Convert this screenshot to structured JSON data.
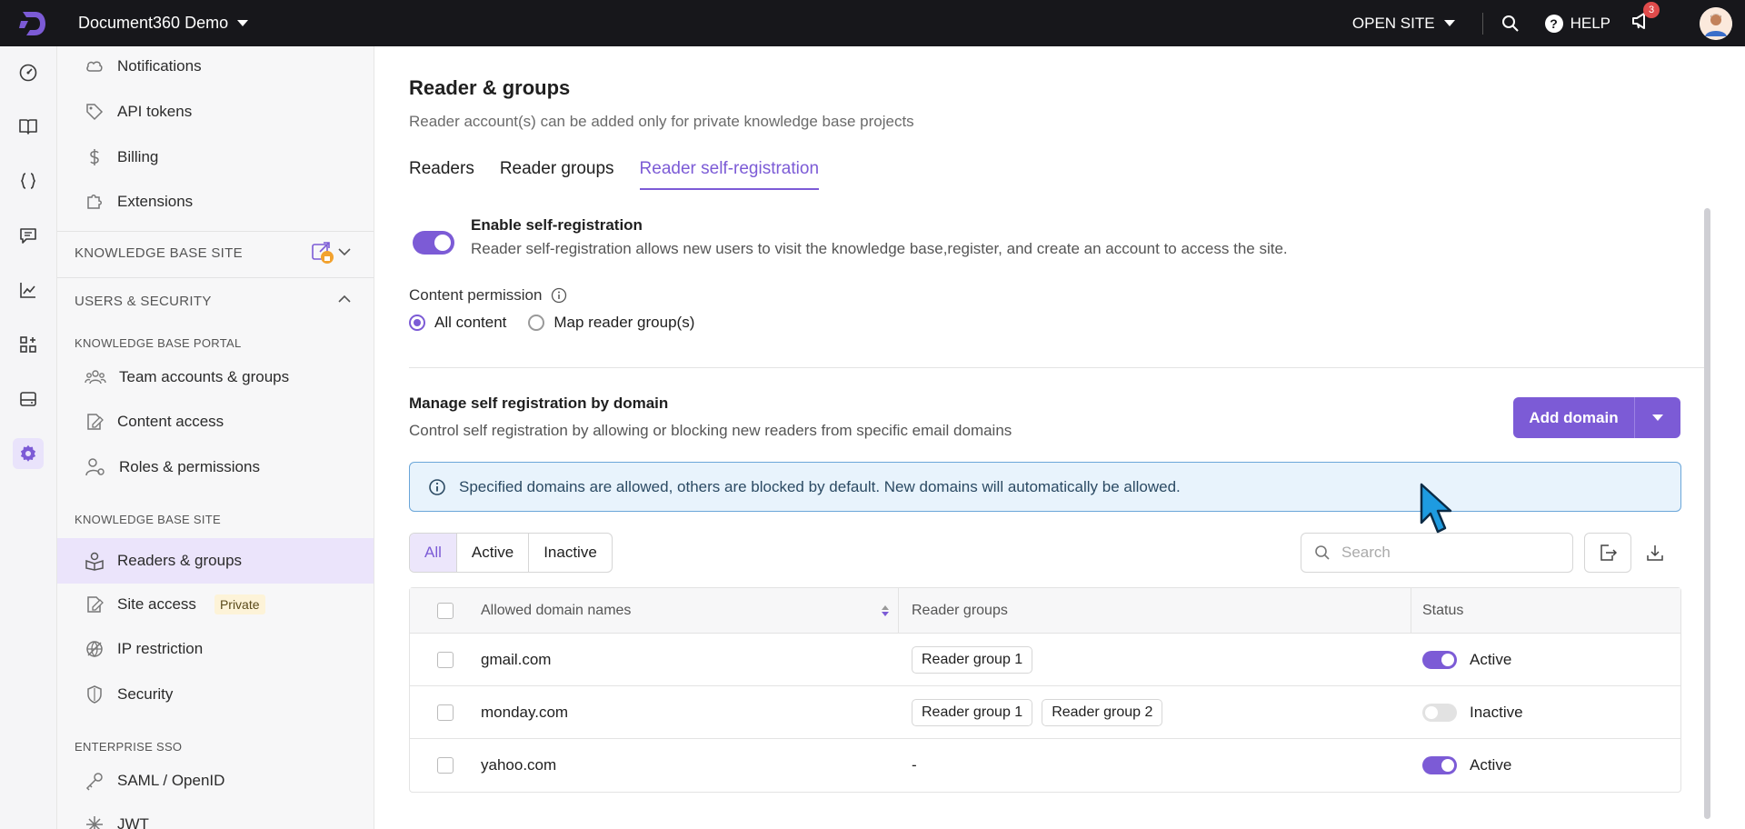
{
  "topbar": {
    "project_name": "Document360 Demo",
    "open_site_label": "OPEN SITE",
    "help_label": "HELP",
    "notification_count": "3"
  },
  "sidebar": {
    "items_top": [
      {
        "label": "Notifications",
        "icon": "cloud-bell-icon"
      },
      {
        "label": "API tokens",
        "icon": "tag-icon"
      },
      {
        "label": "Billing",
        "icon": "dollar-icon"
      },
      {
        "label": "Extensions",
        "icon": "puzzle-icon"
      }
    ],
    "section_kb_site": "KNOWLEDGE BASE SITE",
    "section_users_security": "USERS & SECURITY",
    "sub_kb_portal": "KNOWLEDGE BASE PORTAL",
    "portal_items": [
      {
        "label": "Team accounts & groups",
        "icon": "team-icon"
      },
      {
        "label": "Content access",
        "icon": "content-access-icon"
      },
      {
        "label": "Roles & permissions",
        "icon": "roles-icon"
      }
    ],
    "sub_kb_site": "KNOWLEDGE BASE SITE",
    "site_items": [
      {
        "label": "Readers & groups",
        "icon": "readers-icon"
      },
      {
        "label": "Site access",
        "icon": "site-access-icon",
        "tag": "Private"
      },
      {
        "label": "IP restriction",
        "icon": "globe-icon"
      },
      {
        "label": "Security",
        "icon": "shield-icon"
      }
    ],
    "sub_enterprise_sso": "ENTERPRISE SSO",
    "sso_items": [
      {
        "label": "SAML / OpenID",
        "icon": "key-icon"
      },
      {
        "label": "JWT",
        "icon": "jwt-icon"
      }
    ]
  },
  "main": {
    "title": "Reader & groups",
    "subtitle": "Reader account(s) can be added only for private knowledge base projects",
    "tabs": [
      {
        "label": "Readers"
      },
      {
        "label": "Reader groups"
      },
      {
        "label": "Reader self-registration"
      }
    ],
    "self_registration": {
      "title": "Enable self-registration",
      "description": "Reader self-registration allows new users to visit the knowledge base,register, and create an account to access the site."
    },
    "content_permission": {
      "label": "Content permission",
      "options": [
        {
          "label": "All content"
        },
        {
          "label": "Map reader group(s)"
        }
      ]
    },
    "domains": {
      "title": "Manage self registration by domain",
      "subtitle": "Control self registration by allowing or blocking new readers from specific email domains",
      "add_label": "Add domain",
      "banner": "Specified domains are allowed, others are blocked by default. New domains will automatically be allowed.",
      "filters": [
        {
          "label": "All"
        },
        {
          "label": "Active"
        },
        {
          "label": "Inactive"
        }
      ],
      "search_placeholder": "Search",
      "columns": {
        "domain": "Allowed domain names",
        "groups": "Reader groups",
        "status": "Status"
      },
      "rows": [
        {
          "domain": "gmail.com",
          "groups": [
            "Reader group 1"
          ],
          "status": "Active"
        },
        {
          "domain": "monday.com",
          "groups": [
            "Reader group 1",
            "Reader group 2"
          ],
          "status": "Inactive"
        },
        {
          "domain": "yahoo.com",
          "groups_empty": "-",
          "status": "Active"
        }
      ]
    }
  },
  "colors": {
    "accent": "#7c5bd6",
    "topbar": "#17171b",
    "banner_bg": "#e8f3fc"
  }
}
